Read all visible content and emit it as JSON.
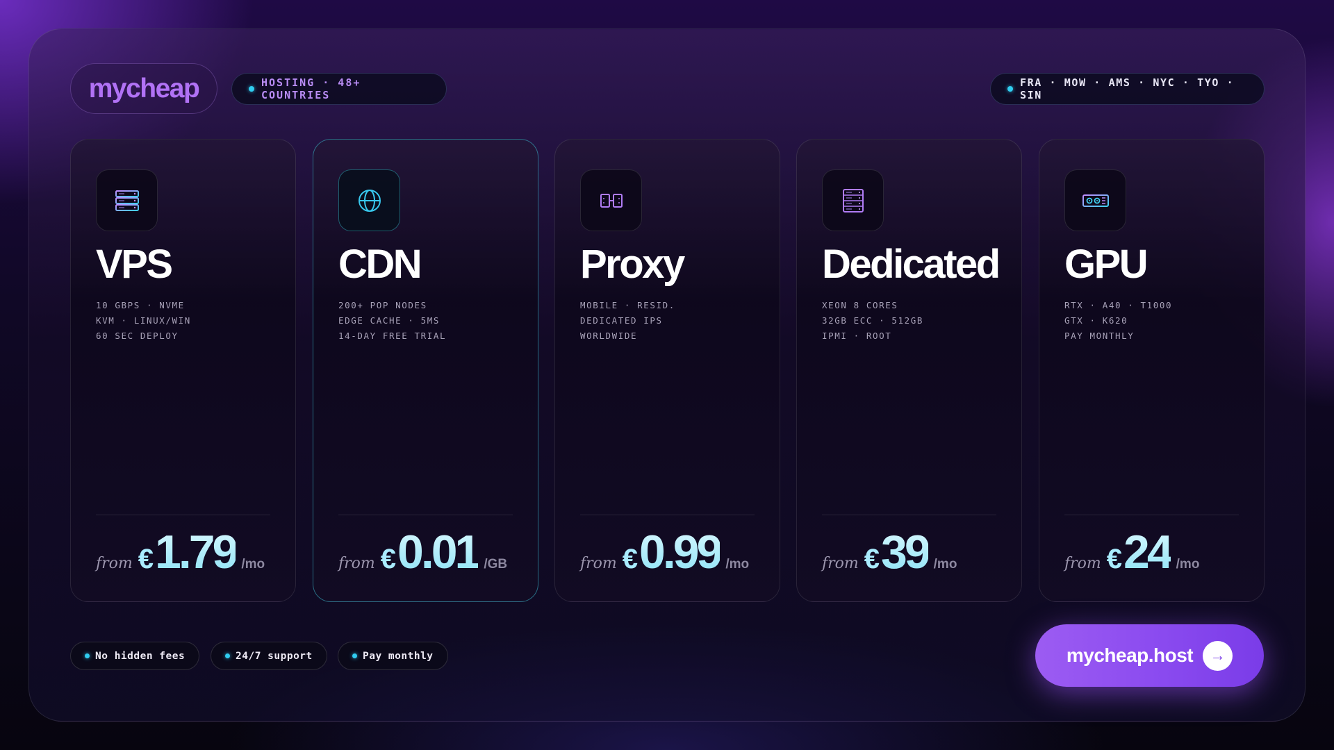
{
  "brand": {
    "logo": "mycheap"
  },
  "header": {
    "tagline": "HOSTING · 48+ COUNTRIES",
    "locations": "FRA · MOW · AMS · NYC · TYO · SIN"
  },
  "cards": [
    {
      "icon": "server-stack-icon",
      "title": "VPS",
      "specs": [
        "10 GBPS · NVME",
        "KVM · LINUX/WIN",
        "60 SEC DEPLOY"
      ],
      "from": "from",
      "currency": "€",
      "price": "1.79",
      "unit": "/mo"
    },
    {
      "icon": "globe-icon",
      "title": "CDN",
      "specs": [
        "200+ POP NODES",
        "EDGE CACHE · 5MS",
        "14-DAY FREE TRIAL"
      ],
      "from": "from",
      "currency": "€",
      "price": "0.01",
      "unit": "/GB"
    },
    {
      "icon": "proxy-icon",
      "title": "Proxy",
      "specs": [
        "MOBILE · RESID.",
        "DEDICATED IPS",
        "WORLDWIDE"
      ],
      "from": "from",
      "currency": "€",
      "price": "0.99",
      "unit": "/mo"
    },
    {
      "icon": "server-rack-icon",
      "title": "Dedicated",
      "specs": [
        "XEON 8 CORES",
        "32GB ECC · 512GB",
        "IPMI · ROOT"
      ],
      "from": "from",
      "currency": "€",
      "price": "39",
      "unit": "/mo"
    },
    {
      "icon": "gpu-card-icon",
      "title": "GPU",
      "specs": [
        "RTX · A40 · T1000",
        "GTX · K620",
        "PAY MONTHLY"
      ],
      "from": "from",
      "currency": "€",
      "price": "24",
      "unit": "/mo"
    }
  ],
  "features": [
    "No hidden fees",
    "24/7 support",
    "Pay monthly"
  ],
  "cta": {
    "label": "mycheap.host",
    "arrow": "→"
  },
  "colors": {
    "accent": "#9c5cf2",
    "cyan": "#30cdf0",
    "price": "#b7f1ff"
  }
}
